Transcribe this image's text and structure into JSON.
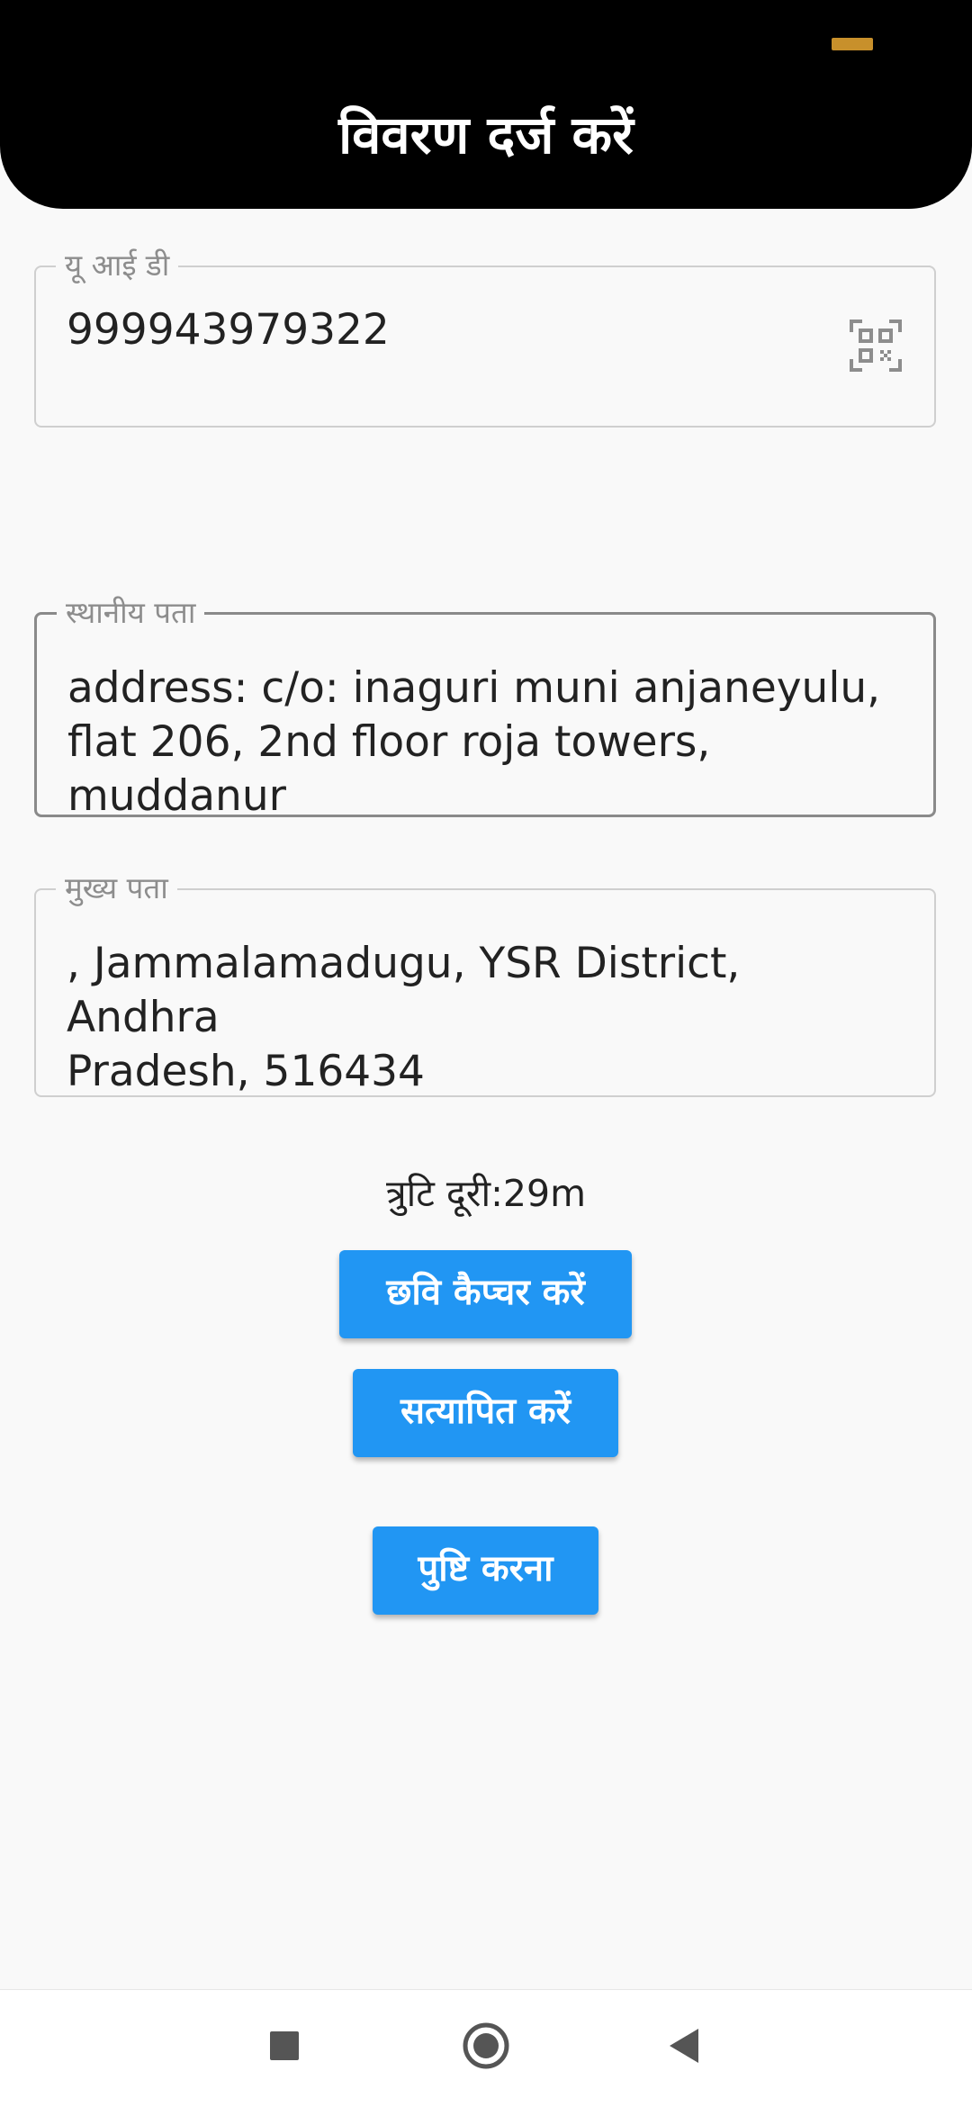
{
  "header": {
    "title": "विवरण दर्ज करें"
  },
  "uid_field": {
    "label": "यू आई डी",
    "value": "999943979322",
    "icon": "qr-code-scan-icon"
  },
  "local_address_field": {
    "label": "स्थानीय पता",
    "value": "address: c/o: inaguri muni anjaneyulu,\nflat 206, 2nd floor roja towers, muddanur"
  },
  "main_address_field": {
    "label": "मुख्य पता",
    "value": ", Jammalamadugu, YSR District, Andhra\nPradesh, 516434"
  },
  "error_distance": "त्रुटि दूरी:29m",
  "buttons": {
    "capture_image": "छवि कैप्चर करें",
    "verify": "सत्यापित करें",
    "confirm": "पुष्टि करना"
  },
  "colors": {
    "header_bg": "#000000",
    "accent": "#2196f3",
    "status_indicator": "#c8902b",
    "page_bg": "#f9f9f9"
  },
  "nav": {
    "icons": [
      "square-recents-icon",
      "circle-home-icon",
      "triangle-back-icon"
    ]
  }
}
